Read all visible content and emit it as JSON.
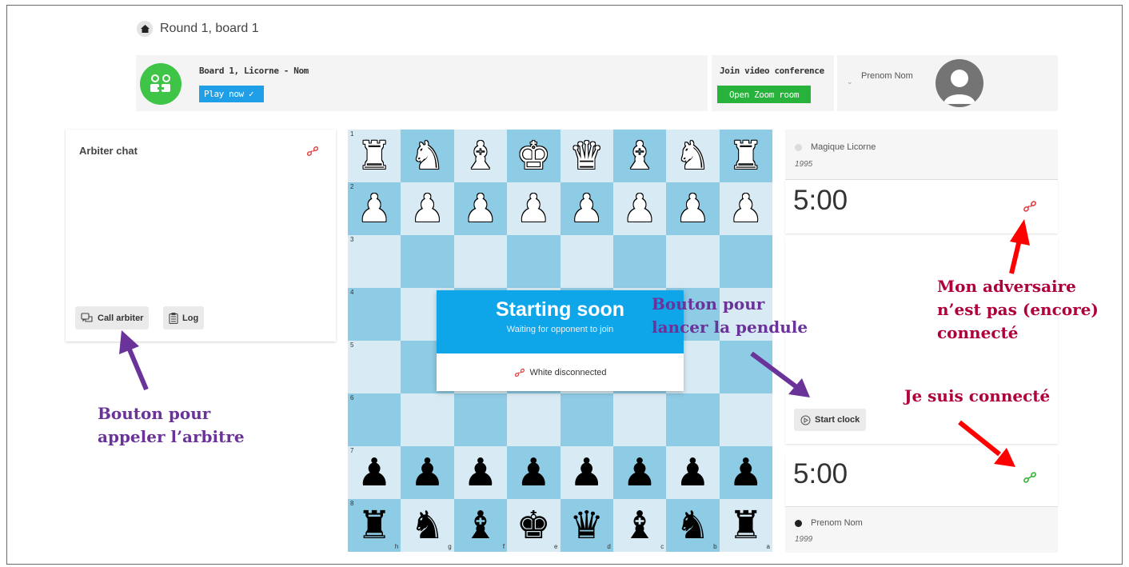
{
  "breadcrumb": {
    "text": "Round 1, board 1"
  },
  "board_card": {
    "title": "Board 1, Licorne - Nom",
    "play_label": "Play now ✓"
  },
  "zoom_card": {
    "title": "Join video conference",
    "button_label": "Open Zoom room"
  },
  "user_card": {
    "name": "Prenom Nom"
  },
  "chat": {
    "title": "Arbiter chat",
    "call_label": "Call arbiter",
    "log_label": "Log"
  },
  "board": {
    "ranks": [
      "1",
      "2",
      "3",
      "4",
      "5",
      "6",
      "7",
      "8"
    ],
    "files": [
      "h",
      "g",
      "f",
      "e",
      "d",
      "c",
      "b",
      "a"
    ],
    "rows": [
      [
        [
          "w",
          "♜"
        ],
        [
          "w",
          "♞"
        ],
        [
          "w",
          "♝"
        ],
        [
          "w",
          "♚"
        ],
        [
          "w",
          "♛"
        ],
        [
          "w",
          "♝"
        ],
        [
          "w",
          "♞"
        ],
        [
          "w",
          "♜"
        ]
      ],
      [
        [
          "w",
          "♟"
        ],
        [
          "w",
          "♟"
        ],
        [
          "w",
          "♟"
        ],
        [
          "w",
          "♟"
        ],
        [
          "w",
          "♟"
        ],
        [
          "w",
          "♟"
        ],
        [
          "w",
          "♟"
        ],
        [
          "w",
          "♟"
        ]
      ],
      [
        null,
        null,
        null,
        null,
        null,
        null,
        null,
        null
      ],
      [
        null,
        null,
        null,
        null,
        null,
        null,
        null,
        null
      ],
      [
        null,
        null,
        null,
        null,
        null,
        null,
        null,
        null
      ],
      [
        null,
        null,
        null,
        null,
        null,
        null,
        null,
        null
      ],
      [
        [
          "b",
          "♟"
        ],
        [
          "b",
          "♟"
        ],
        [
          "b",
          "♟"
        ],
        [
          "b",
          "♟"
        ],
        [
          "b",
          "♟"
        ],
        [
          "b",
          "♟"
        ],
        [
          "b",
          "♟"
        ],
        [
          "b",
          "♟"
        ]
      ],
      [
        [
          "b",
          "♜"
        ],
        [
          "b",
          "♞"
        ],
        [
          "b",
          "♝"
        ],
        [
          "b",
          "♚"
        ],
        [
          "b",
          "♛"
        ],
        [
          "b",
          "♝"
        ],
        [
          "b",
          "♞"
        ],
        [
          "b",
          "♜"
        ]
      ]
    ]
  },
  "overlay": {
    "title": "Starting soon",
    "subtitle": "Waiting for opponent to join",
    "status": "White disconnected"
  },
  "opponent": {
    "name": "Magique Licorne",
    "rating": "1995",
    "clock": "5:00"
  },
  "controls": {
    "start_clock_label": "Start clock"
  },
  "me": {
    "name": "Prenom Nom",
    "rating": "1999",
    "clock": "5:00"
  },
  "annotations": {
    "call_arbiter": [
      "Bouton pour",
      "appeler l’arbitre"
    ],
    "start_clock": [
      "Bouton pour",
      "lancer la pendule"
    ],
    "opponent_status": [
      "Mon adversaire",
      "n’est pas (encore)",
      "connecté"
    ],
    "my_status": [
      "Je suis connecté"
    ]
  },
  "colors": {
    "accent_blue": "#1e9fe8",
    "overlay_blue": "#0fa5e9",
    "zoom_green": "#27b33b",
    "connected_green": "#3ab53a",
    "disconnected_red": "#e04545",
    "annotation_purple": "#6a339a",
    "annotation_red": "#b0003a",
    "square_light": "#d8ebf4",
    "square_dark": "#8ecbe4"
  },
  "icons": [
    "home-icon",
    "board-player-icon",
    "user-avatar-icon",
    "disconnected-link-icon",
    "connected-link-icon",
    "chat-icon",
    "log-icon",
    "play-circle-icon"
  ]
}
